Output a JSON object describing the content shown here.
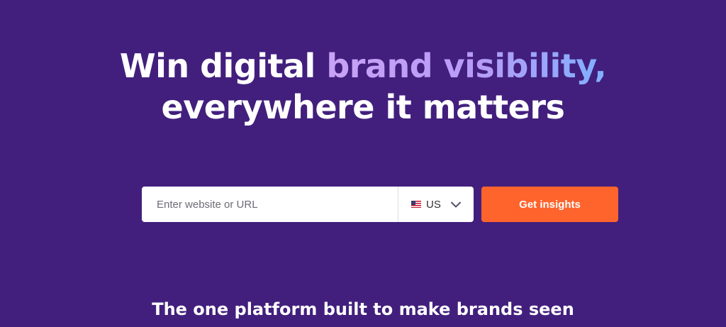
{
  "hero": {
    "headline_part1": "Win digital ",
    "headline_accent": "brand visibility,",
    "headline_line2": "everywhere it matters",
    "subheadline": "The one platform built to make brands seen"
  },
  "search": {
    "placeholder": "Enter website or URL",
    "value": "",
    "country": "US",
    "flag_icon": "us-flag-icon",
    "dropdown_icon": "chevron-down-icon"
  },
  "cta": {
    "label": "Get insights"
  },
  "colors": {
    "background": "#421f7d",
    "accent_gradient_start": "#c9a2f5",
    "accent_gradient_end": "#7fb1ff",
    "cta": "#ff642d"
  }
}
